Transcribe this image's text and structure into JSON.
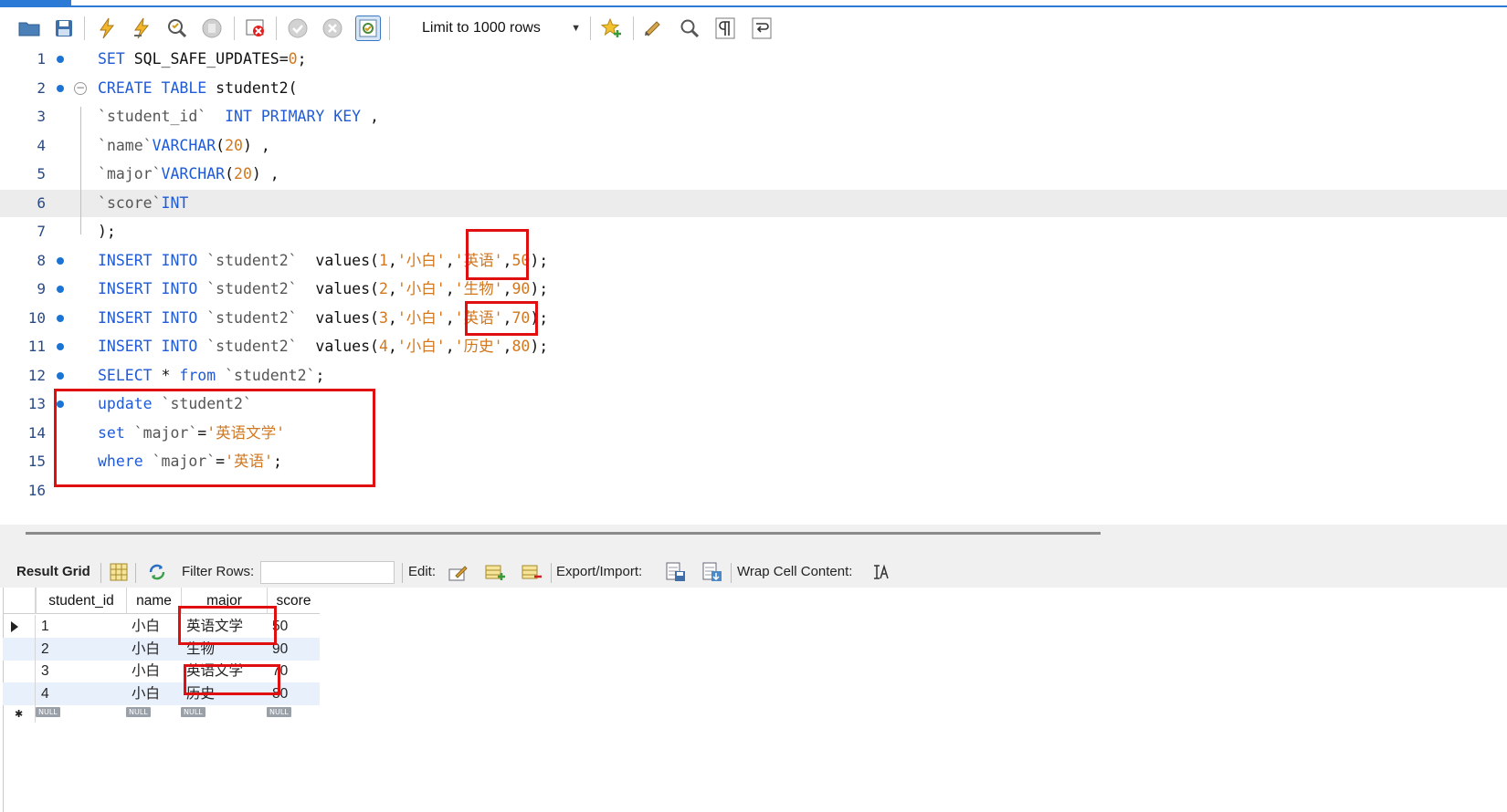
{
  "toolbar": {
    "icons": [
      "open-folder-icon",
      "save-icon",
      "execute-icon",
      "execute-current-icon",
      "explain-icon",
      "stop-icon",
      "toggle-error-icon",
      "commit-icon",
      "rollback-icon",
      "autocommit-icon",
      "add-snippet-icon",
      "beautify-icon",
      "find-icon",
      "invisible-chars-icon",
      "wrap-icon"
    ],
    "limit_label": "Limit to 1000 rows"
  },
  "editor": {
    "lines": [
      {
        "n": "1",
        "dot": true,
        "tokens": [
          [
            "kw",
            "SET "
          ],
          [
            "pl",
            "SQL_SAFE_UPDATES="
          ],
          [
            "num",
            "0"
          ],
          [
            "pl",
            ";"
          ]
        ]
      },
      {
        "n": "2",
        "dot": true,
        "fold": true,
        "tokens": [
          [
            "kw",
            "CREATE TABLE "
          ],
          [
            "pl",
            "student2("
          ]
        ]
      },
      {
        "n": "3",
        "tokens": [
          [
            "tk",
            "`"
          ],
          [
            "tk",
            "student_id"
          ],
          [
            "tk",
            "`"
          ],
          [
            "kw",
            "  INT PRIMARY KEY "
          ],
          [
            "pl",
            ","
          ]
        ]
      },
      {
        "n": "4",
        "tokens": [
          [
            "tk",
            "`"
          ],
          [
            "tk",
            "name"
          ],
          [
            "tk",
            "`"
          ],
          [
            "kw",
            "VARCHAR"
          ],
          [
            "pl",
            "("
          ],
          [
            "num",
            "20"
          ],
          [
            "pl",
            ") ,"
          ]
        ]
      },
      {
        "n": "5",
        "tokens": [
          [
            "tk",
            "`"
          ],
          [
            "tk",
            "major"
          ],
          [
            "tk",
            "`"
          ],
          [
            "kw",
            "VARCHAR"
          ],
          [
            "pl",
            "("
          ],
          [
            "num",
            "20"
          ],
          [
            "pl",
            ") ,"
          ]
        ]
      },
      {
        "n": "6",
        "hl": true,
        "tokens": [
          [
            "tk",
            "`"
          ],
          [
            "tk",
            "score"
          ],
          [
            "tk",
            "`"
          ],
          [
            "kw",
            "INT"
          ]
        ]
      },
      {
        "n": "7",
        "tokens": [
          [
            "pl",
            ");"
          ]
        ]
      },
      {
        "n": "8",
        "dot": true,
        "tokens": [
          [
            "kw",
            "INSERT INTO "
          ],
          [
            "tk",
            "`student2`"
          ],
          [
            "pl",
            "  values("
          ],
          [
            "num",
            "1"
          ],
          [
            "pl",
            ","
          ],
          [
            "str",
            "'小白'"
          ],
          [
            "pl",
            ","
          ],
          [
            "str",
            "'英语'"
          ],
          [
            "pl",
            ","
          ],
          [
            "num",
            "50"
          ],
          [
            "pl",
            ");"
          ]
        ]
      },
      {
        "n": "9",
        "dot": true,
        "tokens": [
          [
            "kw",
            "INSERT INTO "
          ],
          [
            "tk",
            "`student2`"
          ],
          [
            "pl",
            "  values("
          ],
          [
            "num",
            "2"
          ],
          [
            "pl",
            ","
          ],
          [
            "str",
            "'小白'"
          ],
          [
            "pl",
            ","
          ],
          [
            "str",
            "'生物'"
          ],
          [
            "pl",
            ","
          ],
          [
            "num",
            "90"
          ],
          [
            "pl",
            ");"
          ]
        ]
      },
      {
        "n": "10",
        "dot": true,
        "tokens": [
          [
            "kw",
            "INSERT INTO "
          ],
          [
            "tk",
            "`student2`"
          ],
          [
            "pl",
            "  values("
          ],
          [
            "num",
            "3"
          ],
          [
            "pl",
            ","
          ],
          [
            "str",
            "'小白'"
          ],
          [
            "pl",
            ","
          ],
          [
            "str",
            "'英语'"
          ],
          [
            "pl",
            ","
          ],
          [
            "num",
            "70"
          ],
          [
            "pl",
            ");"
          ]
        ]
      },
      {
        "n": "11",
        "dot": true,
        "tokens": [
          [
            "kw",
            "INSERT INTO "
          ],
          [
            "tk",
            "`student2`"
          ],
          [
            "pl",
            "  values("
          ],
          [
            "num",
            "4"
          ],
          [
            "pl",
            ","
          ],
          [
            "str",
            "'小白'"
          ],
          [
            "pl",
            ","
          ],
          [
            "str",
            "'历史'"
          ],
          [
            "pl",
            ","
          ],
          [
            "num",
            "80"
          ],
          [
            "pl",
            ");"
          ]
        ]
      },
      {
        "n": "12",
        "dot": true,
        "tokens": [
          [
            "kw",
            "SELECT "
          ],
          [
            "pl",
            "* "
          ],
          [
            "kw",
            "from "
          ],
          [
            "tk",
            "`student2`"
          ],
          [
            "pl",
            ";"
          ]
        ]
      },
      {
        "n": "13",
        "dot": true,
        "tokens": [
          [
            "kw",
            "update "
          ],
          [
            "tk",
            "`student2`"
          ]
        ]
      },
      {
        "n": "14",
        "tokens": [
          [
            "kw",
            "set "
          ],
          [
            "tk",
            "`major`"
          ],
          [
            "pl",
            "="
          ],
          [
            "str",
            "'英语文学'"
          ]
        ]
      },
      {
        "n": "15",
        "tokens": [
          [
            "kw",
            "where "
          ],
          [
            "tk",
            "`major`"
          ],
          [
            "pl",
            "="
          ],
          [
            "str",
            "'英语'"
          ],
          [
            "pl",
            ";"
          ]
        ]
      },
      {
        "n": "16",
        "tokens": []
      }
    ]
  },
  "result_toolbar": {
    "result_grid_label": "Result Grid",
    "filter_label": "Filter Rows:",
    "filter_value": "",
    "edit_label": "Edit:",
    "export_label": "Export/Import:",
    "wrap_label": "Wrap Cell Content:"
  },
  "grid": {
    "columns": [
      "student_id",
      "name",
      "major",
      "score"
    ],
    "rows": [
      [
        "1",
        "小白",
        "英语文学",
        "50"
      ],
      [
        "2",
        "小白",
        "生物",
        "90"
      ],
      [
        "3",
        "小白",
        "英语文学",
        "70"
      ],
      [
        "4",
        "小白",
        "历史",
        "80"
      ]
    ],
    "null_label": "NULL"
  },
  "colors": {
    "keyword": "#1f5bd6",
    "string": "#d2771e",
    "annotation": "#e01010",
    "alt_row": "#e8f0fb"
  }
}
